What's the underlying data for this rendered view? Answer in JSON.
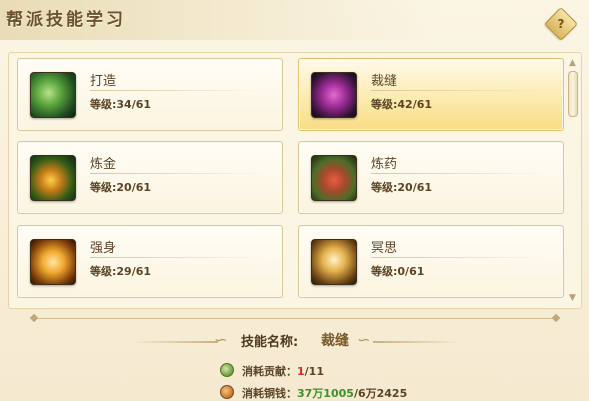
{
  "window": {
    "title": "帮派技能学习",
    "help_label": "?"
  },
  "skills": [
    {
      "name": "打造",
      "level": "等级:34/61",
      "icon": "forge-hammer-icon",
      "selected": false
    },
    {
      "name": "裁缝",
      "level": "等级:42/61",
      "icon": "tailoring-icon",
      "selected": true
    },
    {
      "name": "炼金",
      "level": "等级:20/61",
      "icon": "alchemy-icon",
      "selected": false
    },
    {
      "name": "炼药",
      "level": "等级:20/61",
      "icon": "medicine-icon",
      "selected": false
    },
    {
      "name": "强身",
      "level": "等级:29/61",
      "icon": "body-strength-icon",
      "selected": false
    },
    {
      "name": "冥思",
      "level": "等级:0/61",
      "icon": "meditation-icon",
      "selected": false
    }
  ],
  "detail": {
    "skill_name_label": "技能名称:",
    "skill_name_value": "裁缝",
    "contribution_label": "消耗贡献：",
    "contribution_current": "1",
    "contribution_total": "/11",
    "copper_label": "消耗铜钱：",
    "copper_current": "37万1005",
    "copper_total": "/6万2425"
  },
  "colors": {
    "selected_card": "#f8dd85",
    "insufficient": "#c6332a",
    "available": "#3f8f2a"
  }
}
